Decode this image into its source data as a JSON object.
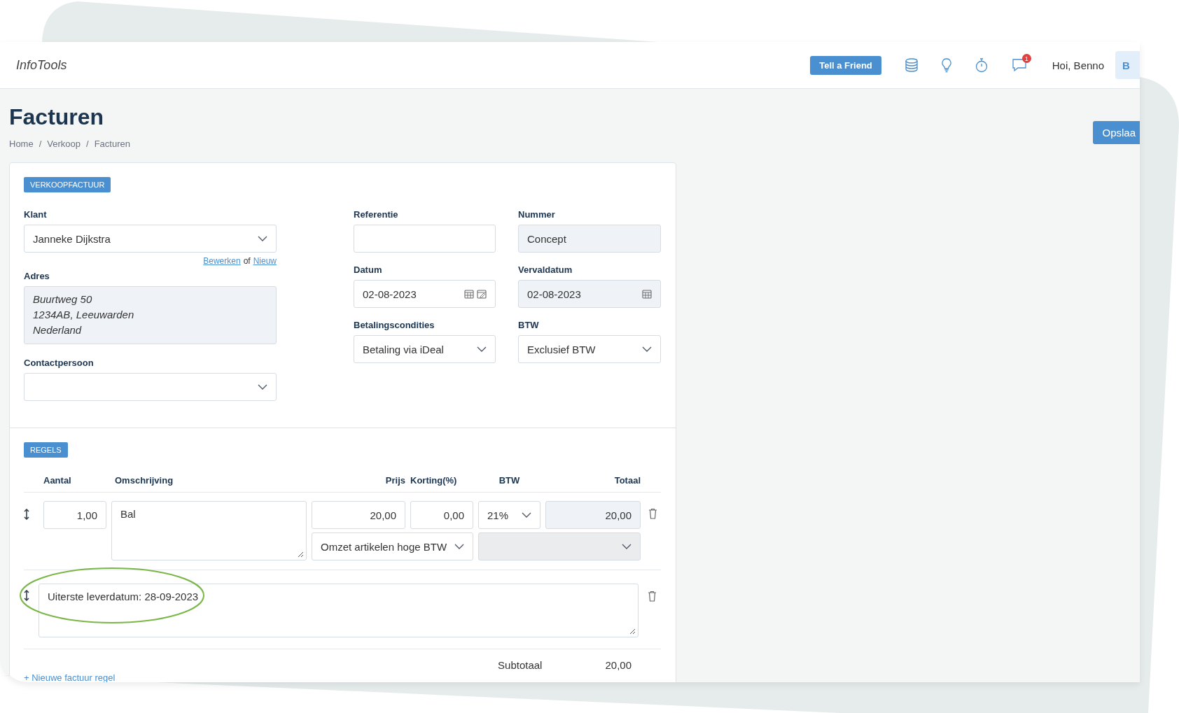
{
  "header": {
    "logo": "InfoTools",
    "tell_a_friend": "Tell a Friend",
    "notification_count": "1",
    "greeting": "Hoi, Benno",
    "avatar": "B"
  },
  "page": {
    "title": "Facturen",
    "breadcrumb": [
      "Home",
      "Verkoop",
      "Facturen"
    ],
    "breadcrumb_separator": "/",
    "save_button": "Opslaa"
  },
  "invoice": {
    "badge": "VERKOOPFACTUUR",
    "klant": {
      "label": "Klant",
      "value": "Janneke Dijkstra",
      "kind": "select",
      "disabled": false
    },
    "klant_links": {
      "edit": "Bewerken",
      "joiner": "of",
      "new": "Nieuw"
    },
    "adres": {
      "label": "Adres",
      "lines": [
        "Buurtweg 50",
        "1234AB, Leeuwarden",
        "Nederland"
      ],
      "disabled": true
    },
    "contactpersoon": {
      "label": "Contactpersoon",
      "kind": "select",
      "disabled": false
    },
    "right_fields": [
      {
        "label": "Referentie",
        "kind": "text",
        "disabled": false
      },
      {
        "label": "Nummer",
        "value": "Concept",
        "kind": "text",
        "disabled": true
      },
      {
        "label": "Datum",
        "value": "02-08-2023",
        "kind": "date",
        "disabled": false
      },
      {
        "label": "Vervaldatum",
        "value": "02-08-2023",
        "kind": "date",
        "disabled": true
      },
      {
        "label": "Betalingscondities",
        "value": "Betaling via iDeal",
        "kind": "select",
        "disabled": false
      },
      {
        "label": "BTW",
        "value": "Exclusief BTW",
        "kind": "select",
        "disabled": false
      }
    ]
  },
  "lines": {
    "badge": "REGELS",
    "columns": [
      "Aantal",
      "Omschrijving",
      "Prijs",
      "Korting(%)",
      "BTW",
      "Totaal"
    ],
    "rows": [
      {
        "kind": "product",
        "aantal": "1,00",
        "omschrijving": "Bal",
        "prijs": "20,00",
        "korting": "0,00",
        "btw": "21%",
        "totaal": "20,00",
        "grootboek": "Omzet artikelen hoge BTW",
        "second_select_disabled": true,
        "highlighted": false
      },
      {
        "kind": "text",
        "text": "Uiterste leverdatum: 28-09-2023",
        "highlighted": true
      }
    ],
    "subtotal_label": "Subtotaal",
    "subtotal_value": "20,00",
    "add_line": "+ Nieuwe factuur regel"
  }
}
